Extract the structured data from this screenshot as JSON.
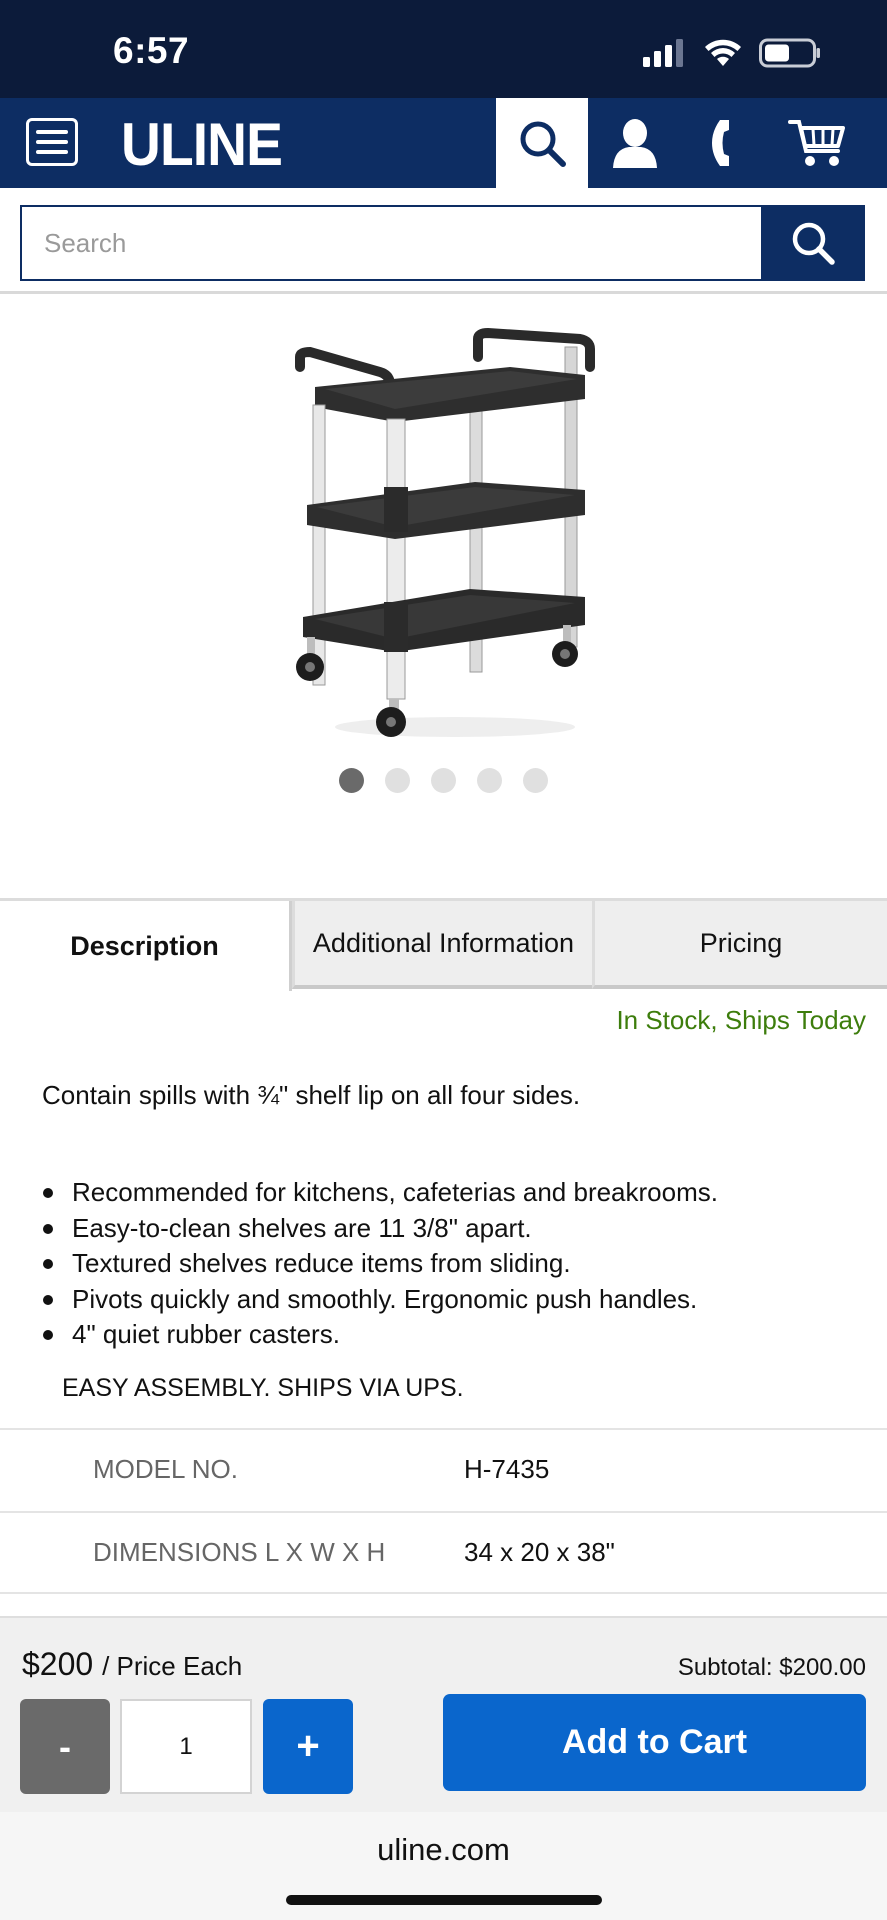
{
  "status_bar": {
    "time": "6:57"
  },
  "header": {
    "logo": "ULINE",
    "brand_color": "#0d2d63"
  },
  "search": {
    "placeholder": "Search"
  },
  "carousel": {
    "total_images": 5,
    "active_index": 0
  },
  "tabs": [
    {
      "label": "Description",
      "active": true
    },
    {
      "label": "Additional Information",
      "active": false
    },
    {
      "label": "Pricing",
      "active": false
    }
  ],
  "description": {
    "stock_status": "In Stock, Ships Today",
    "stock_color": "#3d7d0c",
    "lead": "Contain spills with ¾\" shelf lip on all four sides.",
    "bullets": [
      "Recommended for kitchens, cafeterias and breakrooms.",
      "Easy-to-clean shelves are 11 3/8\" apart.",
      "Textured shelves reduce items from sliding.",
      "Pivots quickly and smoothly. Ergonomic push handles.",
      "4\" quiet rubber casters."
    ],
    "assembly_note": "EASY ASSEMBLY. SHIPS VIA UPS."
  },
  "specs": [
    {
      "label": "MODEL NO.",
      "value": "H-7435"
    },
    {
      "label": "DIMENSIONS L X W X H",
      "value": "34 x 20 x 38\""
    }
  ],
  "purchase": {
    "price": "$200",
    "price_unit": "/ Price Each",
    "subtotal": "Subtotal: $200.00",
    "quantity": "1",
    "minus_label": "-",
    "plus_label": "+",
    "add_to_cart_label": "Add to Cart",
    "accent_color": "#0a66cc"
  },
  "footer": {
    "url": "uline.com"
  }
}
